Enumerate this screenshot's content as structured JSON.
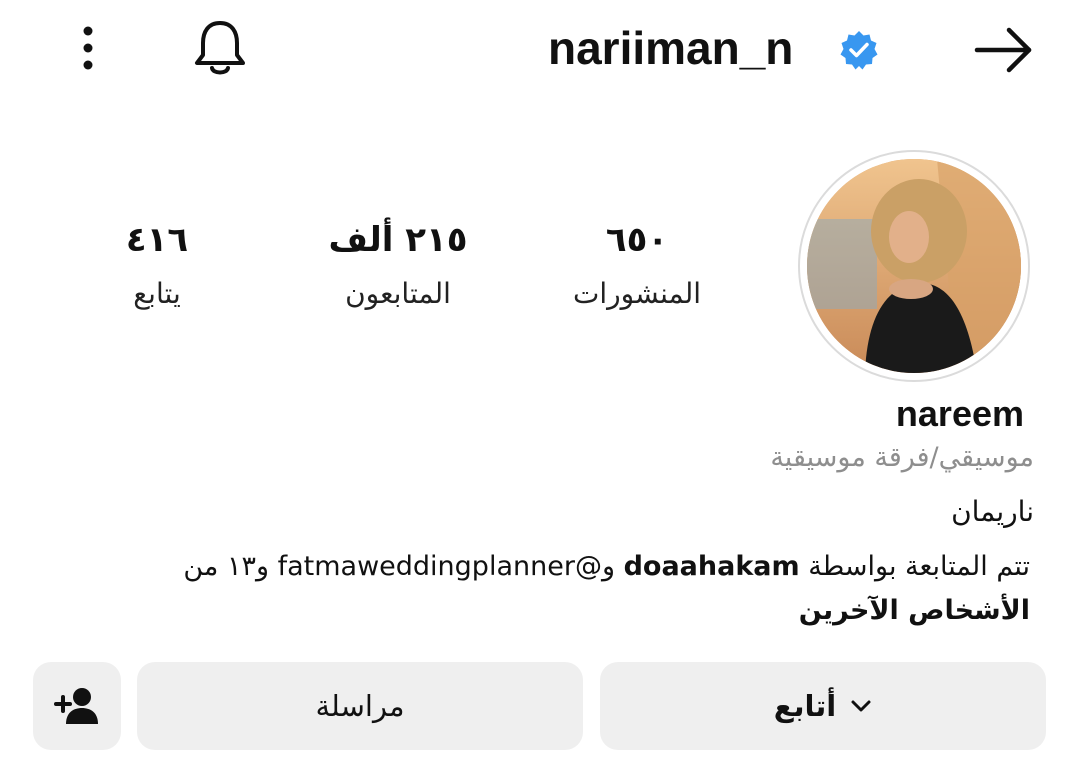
{
  "header": {
    "username": "nariiman_n",
    "icons": {
      "back": "arrow-right-icon",
      "verified": "verified-badge-icon",
      "notifications": "bell-icon",
      "more": "more-vertical-icon"
    },
    "accent": "#3897f0"
  },
  "stats": {
    "posts": {
      "value": "٦٥٠",
      "label": "المنشورات"
    },
    "followers": {
      "value": "٢١٥ ألف",
      "label": "المتابعون"
    },
    "following": {
      "value": "٤١٦",
      "label": "يتابع"
    }
  },
  "profile": {
    "display_name": "nareem",
    "category": "موسيقي/فرقة موسيقية",
    "bio": "ناريمان",
    "followed_by": {
      "prefix": "تتم المتابعة بواسطة",
      "user1": "doaahakam",
      "joiner": "و@fatmaweddingplanner و١٣ من",
      "suffix": "الأشخاص الآخرين"
    }
  },
  "actions": {
    "follow_label": "أتابع",
    "message_label": "مراسلة",
    "icons": {
      "follow_dropdown": "chevron-down-icon",
      "suggest": "add-person-icon"
    }
  }
}
